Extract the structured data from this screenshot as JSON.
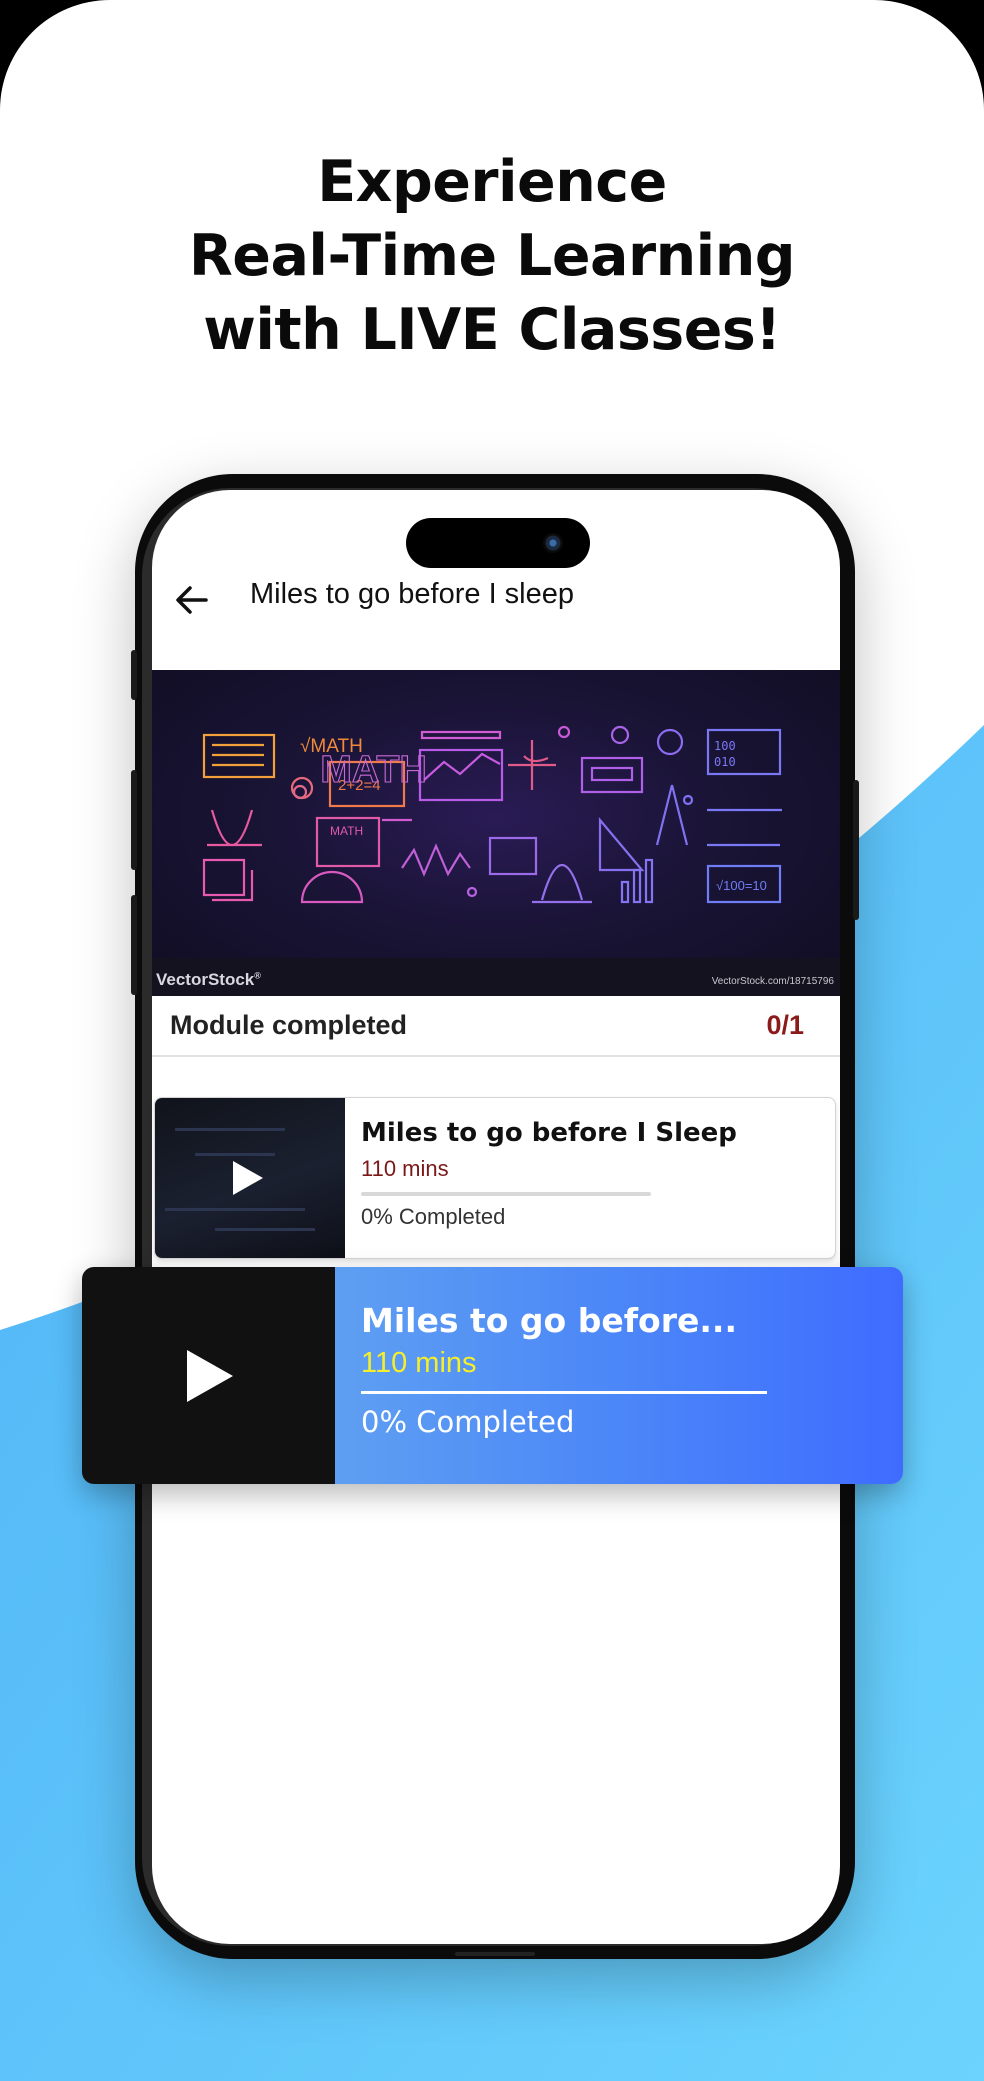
{
  "colors": {
    "wave": "#5ec4fb",
    "accent_blue": "#4a84f8",
    "duration_red": "#7a1818",
    "duration_yellow": "#f4ef2a",
    "counter_red": "#8b1a1a"
  },
  "headline": {
    "line1": "Experience",
    "line2": "Real-Time Learning",
    "line3": "with LIVE Classes!"
  },
  "screen": {
    "back_icon": "arrow-left-icon",
    "title": "Miles to go before I sleep"
  },
  "banner": {
    "math_label": "MATH",
    "sqrt_label": "√MATH",
    "formula": "2+2=4",
    "logo": "VectorStock",
    "logo_mark": "®",
    "url": "VectorStock.com/18715796"
  },
  "module": {
    "label": "Module completed",
    "count": "0/1"
  },
  "lesson_card": {
    "title": "Miles to go before I Sleep",
    "duration": "110 mins",
    "progress_fraction": 0,
    "status": "0% Completed",
    "play_icon": "play-icon"
  },
  "overlay_card": {
    "title": "Miles to go before...",
    "duration": "110 mins",
    "progress_fraction": 0,
    "status": "0% Completed",
    "play_icon": "play-icon"
  }
}
